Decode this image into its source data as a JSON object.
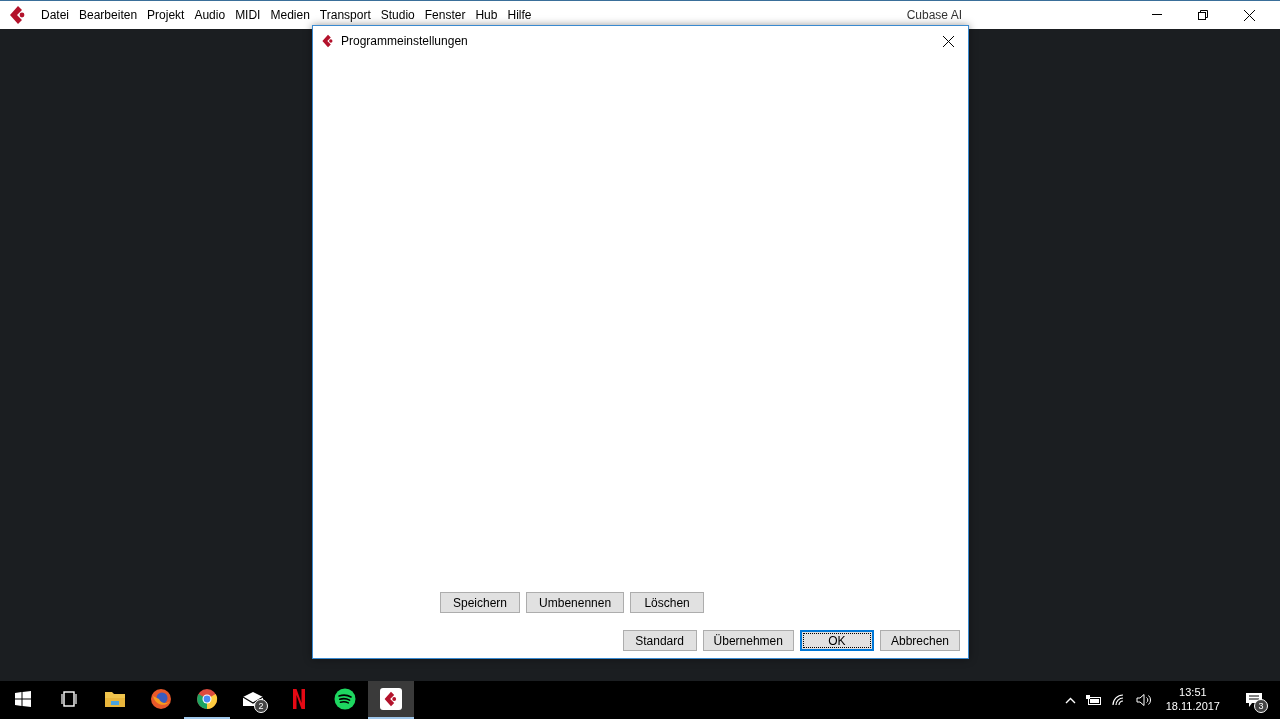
{
  "menu": [
    "Datei",
    "Bearbeiten",
    "Projekt",
    "Audio",
    "MIDI",
    "Medien",
    "Transport",
    "Studio",
    "Fenster",
    "Hub",
    "Hilfe"
  ],
  "window": {
    "title": "Cubase AI"
  },
  "dialog": {
    "title": "Programmeinstellungen",
    "preset_buttons": [
      "Speichern",
      "Umbenennen",
      "Löschen"
    ],
    "buttons": [
      {
        "label": "Standard",
        "focused": false
      },
      {
        "label": "Übernehmen",
        "focused": false
      },
      {
        "label": "OK",
        "focused": true
      },
      {
        "label": "Abbrechen",
        "focused": false
      }
    ]
  },
  "taskbar": {
    "apps": [
      {
        "kind": "start",
        "active": false
      },
      {
        "kind": "taskview",
        "active": false
      },
      {
        "kind": "explorer",
        "active": false
      },
      {
        "kind": "firefox",
        "active": false
      },
      {
        "kind": "chrome",
        "active": true
      },
      {
        "kind": "mail",
        "active": false,
        "badge": "2"
      },
      {
        "kind": "netflix",
        "active": false
      },
      {
        "kind": "spotify",
        "active": false
      },
      {
        "kind": "cubase",
        "active": true
      }
    ],
    "time": "13:51",
    "date": "18.11.2017",
    "notifications": "3"
  }
}
